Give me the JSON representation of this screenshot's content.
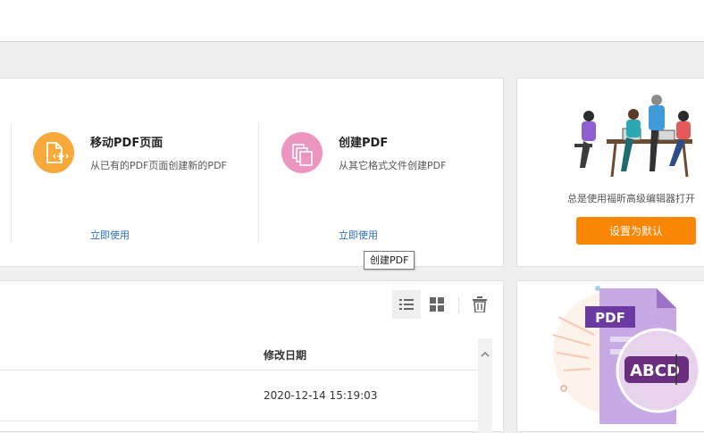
{
  "tools": [
    {
      "title": "移动PDF页面",
      "desc": "从已有的PDF页面创建新的PDF",
      "link": "立即使用",
      "color": "#f7a93a"
    },
    {
      "title": "创建PDF",
      "desc": "从其它格式文件创建PDF",
      "link": "立即使用",
      "color": "#ec96bf"
    }
  ],
  "tooltip": "创建PDF",
  "promo": {
    "text": "总是使用福昕高级编辑器打开",
    "button": "设置为默认",
    "accent": "#fa8605"
  },
  "files": {
    "column_date": "修改日期",
    "rows": [
      {
        "modified": "2020-12-14 15:19:03"
      }
    ]
  },
  "ad": {
    "pdf_label": "PDF",
    "abc_label": "ABCD"
  }
}
